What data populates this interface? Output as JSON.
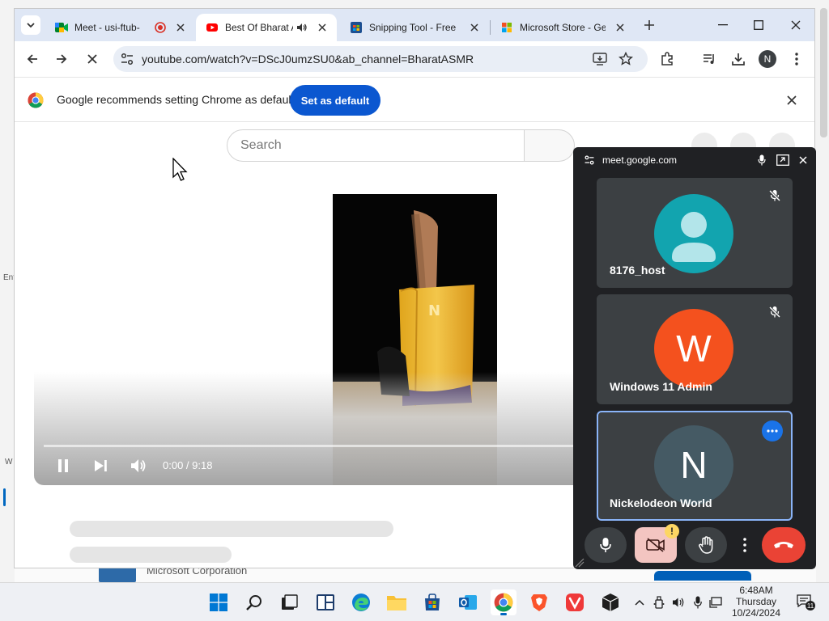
{
  "desktop": {
    "left_hint_1": "Ent",
    "left_hint_2": "W",
    "bg_app_publisher": "Microsoft Corporation"
  },
  "browser": {
    "tabs": [
      {
        "title": "Meet - usi-ftub-",
        "favicon": "google-meet-icon",
        "status_icon": "recording-icon",
        "active": false
      },
      {
        "title": "Best Of Bharat A",
        "favicon": "youtube-icon",
        "status_icon": "speaker-icon",
        "active": true
      },
      {
        "title": "Snipping Tool - Free",
        "favicon": "microsoft-store-icon",
        "active": false
      },
      {
        "title": "Microsoft Store - Ge",
        "favicon": "microsoft-icon",
        "active": false
      }
    ],
    "url": "youtube.com/watch?v=DScJ0umzSU0&ab_channel=BharatASMR",
    "profile_initial": "N",
    "infobar": {
      "message": "Google recommends setting Chrome as default",
      "button": "Set as default"
    }
  },
  "youtube": {
    "search_placeholder": "Search",
    "player": {
      "time": "0:00 / 9:18",
      "progress_fraction": 0.0
    }
  },
  "meet": {
    "host": "meet.google.com",
    "participants": [
      {
        "name": "8176_host",
        "initial": "",
        "avatar_color": "#12a4af",
        "muted": true
      },
      {
        "name": "Windows 11 Admin",
        "initial": "W",
        "avatar_color": "#f4511e",
        "muted": true
      },
      {
        "name": "Nickelodeon World",
        "initial": "N",
        "avatar_color": "#455a64",
        "muted": false,
        "selected": true
      }
    ],
    "colors": {
      "end_call": "#ea4335",
      "camera_off_bg": "#f3c5c1",
      "warning": "#fdd663"
    }
  },
  "taskbar": {
    "time": "6:48AM",
    "day": "Thursday",
    "date": "10/24/2024",
    "notifications": "11"
  }
}
